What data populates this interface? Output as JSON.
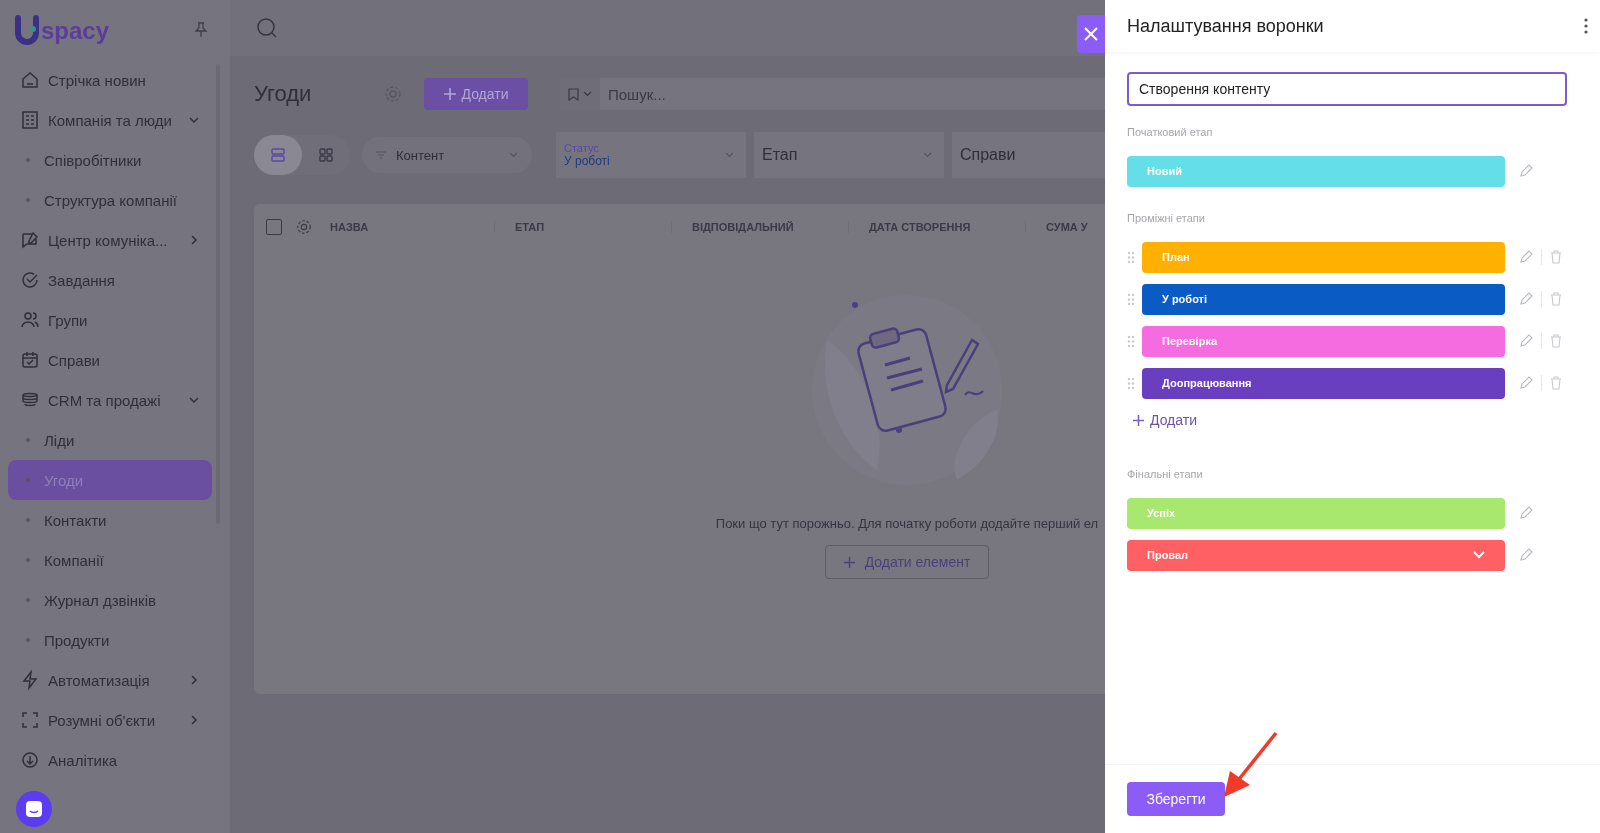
{
  "sidebar": {
    "logo": "spacy",
    "items": [
      {
        "label": "Стрічка новин",
        "kind": "link",
        "selected": false
      },
      {
        "label": "Компанія та люди",
        "kind": "group",
        "expanded": true,
        "selected": false,
        "children": [
          {
            "label": "Співробітники",
            "selected": false
          },
          {
            "label": "Структура компанії",
            "selected": false
          }
        ]
      },
      {
        "label": "Центр комуніка...",
        "kind": "group",
        "expanded": false,
        "selected": false
      },
      {
        "label": "Завдання",
        "kind": "link",
        "selected": false
      },
      {
        "label": "Групи",
        "kind": "link",
        "selected": false
      },
      {
        "label": "Справи",
        "kind": "link",
        "selected": false
      },
      {
        "label": "CRM та продажі",
        "kind": "group",
        "expanded": true,
        "selected": false,
        "children": [
          {
            "label": "Ліди",
            "selected": false
          },
          {
            "label": "Угоди",
            "selected": true
          },
          {
            "label": "Контакти",
            "selected": false
          },
          {
            "label": "Компанії",
            "selected": false
          },
          {
            "label": "Журнал дзвінків",
            "selected": false
          },
          {
            "label": "Продукти",
            "selected": false
          }
        ]
      },
      {
        "label": "Автоматизація",
        "kind": "group",
        "expanded": false,
        "selected": false
      },
      {
        "label": "Розумні об'єкти",
        "kind": "group",
        "expanded": false,
        "selected": false
      },
      {
        "label": "Аналітика",
        "kind": "link",
        "selected": false
      }
    ]
  },
  "main": {
    "title": "Угоди",
    "add_button": "Додати",
    "search": {
      "placeholder": "Пошук..."
    },
    "views": [
      {
        "selected": true
      },
      {
        "selected": false
      }
    ],
    "pipeline_filter": "Контент",
    "filters": [
      {
        "label": "Статус",
        "value": "У роботі"
      },
      {
        "placeholder": "Етап"
      },
      {
        "placeholder": "Справи"
      }
    ],
    "table": {
      "select_all": {
        "checked": false
      },
      "columns": [
        "НАЗВА",
        "ЕТАП",
        "ВІДПОВІДАЛЬНИЙ",
        "ДАТА СТВОРЕННЯ",
        "СУМА У"
      ],
      "empty_text": "Поки що тут порожньо. Для початку роботи додайте перший ел",
      "add_button": "Додати елемент"
    }
  },
  "panel": {
    "title": "Налаштування воронки",
    "name_field": {
      "value": "Створення контенту"
    },
    "sections": [
      {
        "label": "Початковий етап",
        "kind": "initial",
        "stages": [
          {
            "name": "Новий",
            "color": "#64dfe8"
          }
        ]
      },
      {
        "label": "Проміжні етапи",
        "kind": "intermediate",
        "add_link": "Додати",
        "stages": [
          {
            "name": "План",
            "color": "#ffb000"
          },
          {
            "name": "У роботі",
            "color": "#0a5bc4"
          },
          {
            "name": "Перевірка",
            "color": "#f56ce0"
          },
          {
            "name": "Доопрацювання",
            "color": "#6a3fbf"
          }
        ]
      },
      {
        "label": "Фінальні етапи",
        "kind": "final",
        "stages": [
          {
            "name": "Успіх",
            "color": "#a8e86e",
            "kind": "plain"
          },
          {
            "name": "Провал",
            "color": "#fe6064",
            "kind": "select"
          }
        ]
      }
    ],
    "save_button": "Зберегти"
  }
}
